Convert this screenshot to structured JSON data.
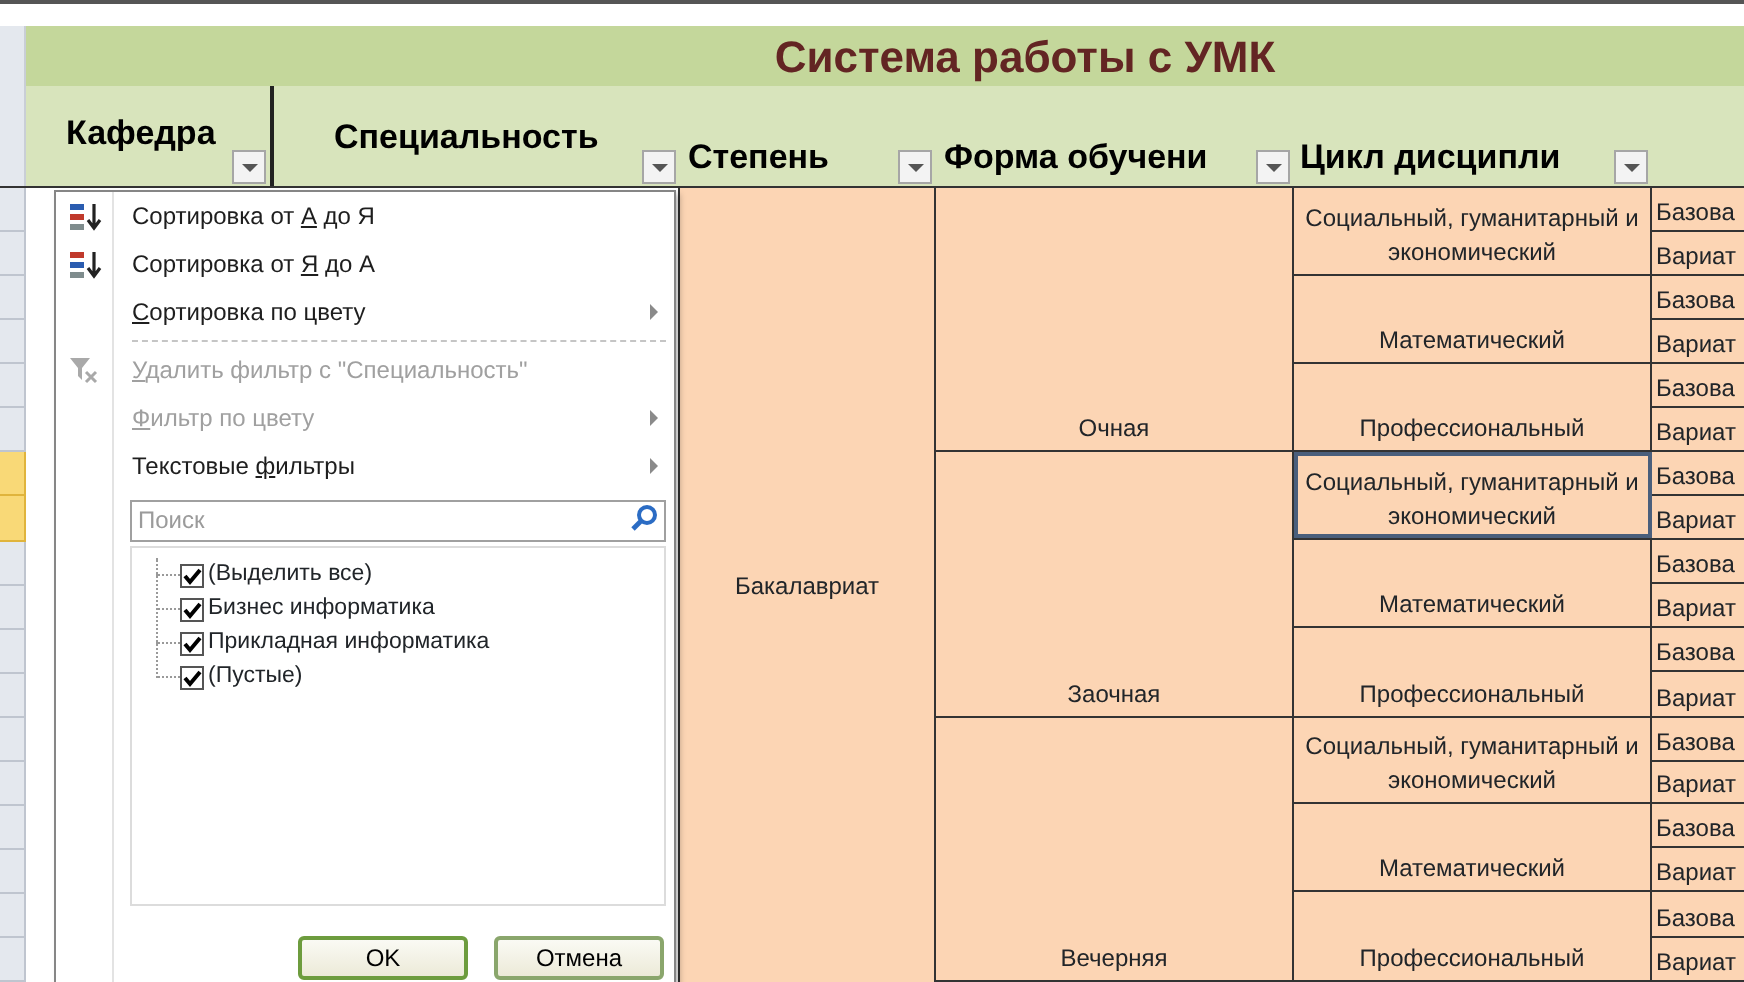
{
  "title": "Система работы с УМК",
  "columns": [
    {
      "label": "Кафедра"
    },
    {
      "label": "Специальность"
    },
    {
      "label": "Степень"
    },
    {
      "label": "Форма обучени"
    },
    {
      "label": "Цикл дисципли"
    }
  ],
  "degrees": [
    {
      "label": "Бакалавриат",
      "forms": [
        {
          "label": "Очная",
          "cycles": [
            {
              "label": "Социальный, гуманитарный и экономический",
              "selected": false,
              "column_5": [
                "Базова",
                "Вариат"
              ]
            },
            {
              "label": "Математический",
              "selected": false,
              "column_5": [
                "Базова",
                "Вариат"
              ]
            },
            {
              "label": "Профессиональный",
              "selected": false,
              "column_5": [
                "Базова",
                "Вариат"
              ]
            }
          ]
        },
        {
          "label": "Заочная",
          "cycles": [
            {
              "label": "Социальный, гуманитарный и экономический",
              "selected": true,
              "column_5": [
                "Базова",
                "Вариат"
              ]
            },
            {
              "label": "Математический",
              "selected": false,
              "column_5": [
                "Базова",
                "Вариат"
              ]
            },
            {
              "label": "Профессиональный",
              "selected": false,
              "column_5": [
                "Базова",
                "Вариат"
              ]
            }
          ]
        },
        {
          "label": "Вечерняя",
          "cycles": [
            {
              "label": "Социальный, гуманитарный и экономический",
              "selected": false,
              "column_5": [
                "Базова",
                "Вариат"
              ]
            },
            {
              "label": "Математический",
              "selected": false,
              "column_5": [
                "Базова",
                "Вариат"
              ]
            },
            {
              "label": "Профессиональный",
              "selected": false,
              "column_5": [
                "Базова",
                "Вариат"
              ]
            }
          ]
        }
      ]
    }
  ],
  "filter_menu": {
    "items": [
      {
        "kind": "sort-ascending",
        "before": "Сортировка от ",
        "key": "А",
        "after": " до Я",
        "disabled": false,
        "submenu": false
      },
      {
        "kind": "sort-descending",
        "before": "Сортировка от ",
        "key": "Я",
        "after": " до А",
        "disabled": false,
        "submenu": false
      },
      {
        "kind": "plain",
        "key": "С",
        "after": "ортировка по цвету",
        "disabled": false,
        "submenu": true
      },
      {
        "kind": "separator"
      },
      {
        "kind": "clear-filter",
        "key": "У",
        "after": "далить фильтр с \"Специальность\"",
        "disabled": true,
        "submenu": false
      },
      {
        "kind": "plain",
        "key": "Ф",
        "after": "ильтр по цвету",
        "disabled": true,
        "submenu": true
      },
      {
        "kind": "plain",
        "before": "Текстовые ",
        "key": "ф",
        "after": "ильтры",
        "disabled": false,
        "submenu": true
      }
    ],
    "search": {
      "placeholder": "Поиск"
    },
    "values": [
      {
        "label": "(Выделить все)",
        "checked": true
      },
      {
        "label": "Бизнес информатика",
        "checked": true
      },
      {
        "label": "Прикладная информатика",
        "checked": true
      },
      {
        "label": "(Пустые)",
        "checked": true
      }
    ],
    "buttons": [
      {
        "label": "OK",
        "default": true
      },
      {
        "label": "Отмена",
        "default": false
      }
    ]
  }
}
